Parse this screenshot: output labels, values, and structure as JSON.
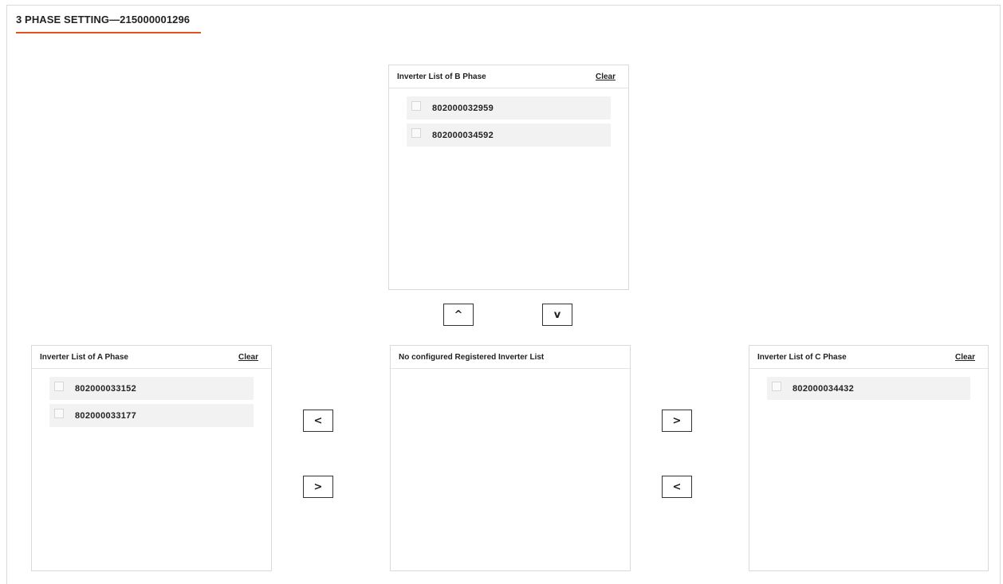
{
  "header": {
    "title": "3 PHASE SETTING—215000001296"
  },
  "panels": {
    "b_phase": {
      "title": "Inverter List of B Phase",
      "clear_label": "Clear",
      "items": [
        {
          "label": "802000032959"
        },
        {
          "label": "802000034592"
        }
      ]
    },
    "a_phase": {
      "title": "Inverter List of A Phase",
      "clear_label": "Clear",
      "items": [
        {
          "label": "802000033152"
        },
        {
          "label": "802000033177"
        }
      ]
    },
    "unconfigured": {
      "title": "No configured Registered Inverter List",
      "items": []
    },
    "c_phase": {
      "title": "Inverter List of C Phase",
      "clear_label": "Clear",
      "items": [
        {
          "label": "802000034432"
        }
      ]
    }
  },
  "buttons": {
    "move_to_b": "^",
    "move_from_b": "v",
    "move_to_a": "<",
    "move_from_a": ">",
    "move_to_c": ">",
    "move_from_c": "<"
  },
  "colors": {
    "accent_underline": "#e0531f",
    "item_background": "#f2f2f2",
    "border": "#d9d9d9"
  }
}
